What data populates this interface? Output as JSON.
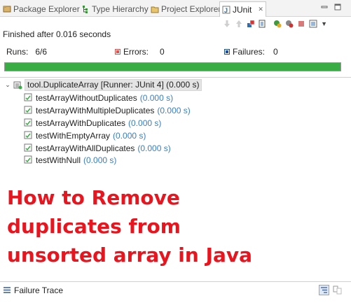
{
  "tabs": [
    {
      "label": "Package Explorer",
      "icon": "package-explorer-icon",
      "active": false
    },
    {
      "label": "Type Hierarchy",
      "icon": "type-hierarchy-icon",
      "active": false
    },
    {
      "label": "Project Explorer",
      "icon": "project-explorer-icon",
      "active": false
    },
    {
      "label": "JUnit",
      "icon": "junit-icon",
      "active": true
    }
  ],
  "status": "Finished after 0.016 seconds",
  "counters": {
    "runs_label": "Runs:",
    "runs_value": "6/6",
    "errors_label": "Errors:",
    "errors_value": "0",
    "failures_label": "Failures:",
    "failures_value": "0"
  },
  "progress": {
    "fraction": 1.0,
    "color": "#3aac45"
  },
  "tree": {
    "root": {
      "name": "tool.DuplicateArray",
      "runner": "[Runner: JUnit 4]",
      "time": "(0.000 s)"
    },
    "tests": [
      {
        "name": "testArrayWithoutDuplicates",
        "time": "(0.000 s)"
      },
      {
        "name": "testArrayWithMultipleDuplicates",
        "time": "(0.000 s)"
      },
      {
        "name": "testArrayWithDuplicates",
        "time": "(0.000 s)"
      },
      {
        "name": "testWithEmptyArray",
        "time": "(0.000 s)"
      },
      {
        "name": "testArrayWithAllDuplicates",
        "time": "(0.000 s)"
      },
      {
        "name": "testWithNull",
        "time": "(0.000 s)"
      }
    ]
  },
  "overlay": {
    "line1": "How to Remove",
    "line2": "duplicates from",
    "line3": "unsorted array in Java",
    "color": "#e8141e"
  },
  "failure_trace": {
    "title": "Failure Trace"
  },
  "colors": {
    "time_blue": "#3a7ec2",
    "error_red": "#d9534f",
    "failure_blue": "#1f4e96"
  }
}
